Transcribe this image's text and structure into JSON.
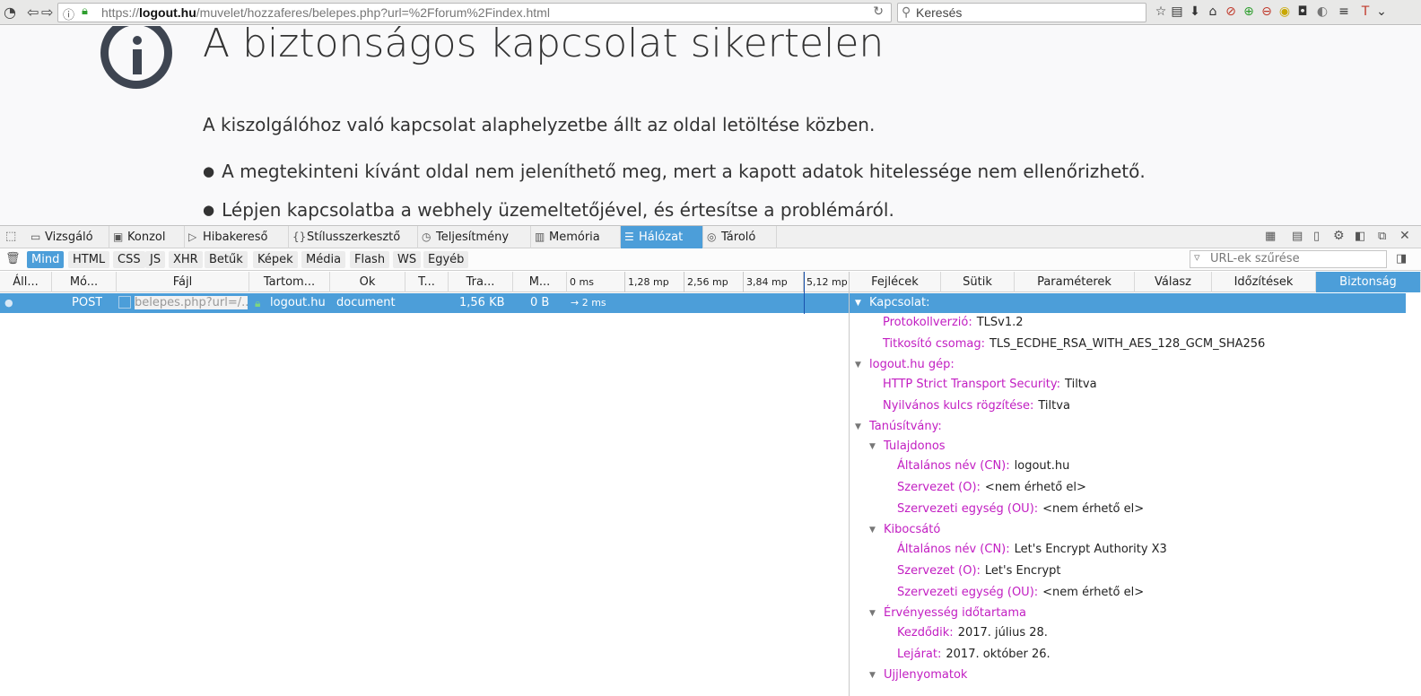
{
  "browser": {
    "url_prefix": "https://",
    "url_domain": "logout.hu",
    "url_path": "/muvelet/hozzaferes/belepes.php?url=%2Fforum%2Findex.html",
    "search_placeholder": "Keresés"
  },
  "error": {
    "title": "A biztonságos kapcsolat sikertelen",
    "description": "A kiszolgálóhoz való kapcsolat alaphelyzetbe állt az oldal letöltése közben.",
    "bullets": [
      "A megtekinteni kívánt oldal nem jeleníthető meg, mert a kapott adatok hitelessége nem ellenőrizhető.",
      "Lépjen kapcsolatba a webhely üzemeltetőjével, és értesítse a problémáról."
    ]
  },
  "devtools": {
    "tabs": [
      "Vizsgáló",
      "Konzol",
      "Hibakereső",
      "Stílusszerkesztő",
      "Teljesítmény",
      "Memória",
      "Hálózat",
      "Tároló"
    ],
    "filters": [
      "Mind",
      "HTML",
      "CSS",
      "JS",
      "XHR",
      "Betűk",
      "Képek",
      "Média",
      "Flash",
      "WS",
      "Egyéb"
    ],
    "url_filter_placeholder": "URL-ek szűrése",
    "columns": [
      "Áll...",
      "Mó...",
      "Fájl",
      "Tartom...",
      "Ok",
      "T...",
      "Tra...",
      "M..."
    ],
    "timeline": [
      "0 ms",
      "1,28 mp",
      "2,56 mp",
      "3,84 mp",
      "5,12 mp"
    ],
    "request": {
      "method": "POST",
      "file": "belepes.php?url=/...",
      "domain": "logout.hu",
      "cause": "document",
      "transferred": "1,56 KB",
      "size": "0 B",
      "timing": "→ 2 ms"
    },
    "side_tabs": [
      "Fejlécek",
      "Sütik",
      "Paraméterek",
      "Válasz",
      "Időzítések",
      "Biztonság"
    ],
    "security": {
      "connection": "Kapcsolat:",
      "protocol_label": "Protokollverzió:",
      "protocol_value": "TLSv1.2",
      "cipher_label": "Titkosító csomag:",
      "cipher_value": "TLS_ECDHE_RSA_WITH_AES_128_GCM_SHA256",
      "host": "logout.hu gép:",
      "hsts_label": "HTTP Strict Transport Security:",
      "hsts_value": "Tiltva",
      "pkp_label": "Nyilvános kulcs rögzítése:",
      "pkp_value": "Tiltva",
      "cert": "Tanúsítvány:",
      "owner": "Tulajdonos",
      "cn_label": "Általános név (CN):",
      "owner_cn": "logout.hu",
      "o_label": "Szervezet (O):",
      "owner_o": "<nem érhető el>",
      "ou_label": "Szervezeti egység (OU):",
      "owner_ou": "<nem érhető el>",
      "issuer": "Kibocsátó",
      "issuer_cn": "Let's Encrypt Authority X3",
      "issuer_o": "Let's Encrypt",
      "issuer_ou": "<nem érhető el>",
      "validity": "Érvényesség időtartama",
      "from_label": "Kezdődik:",
      "from_value": "2017. július 28.",
      "to_label": "Lejárat:",
      "to_value": "2017. október 26.",
      "fingerprints": "Ujjlenyomatok"
    }
  },
  "colors": {
    "accent": "#4c9ed9",
    "key_purple": "#c21ec2"
  }
}
